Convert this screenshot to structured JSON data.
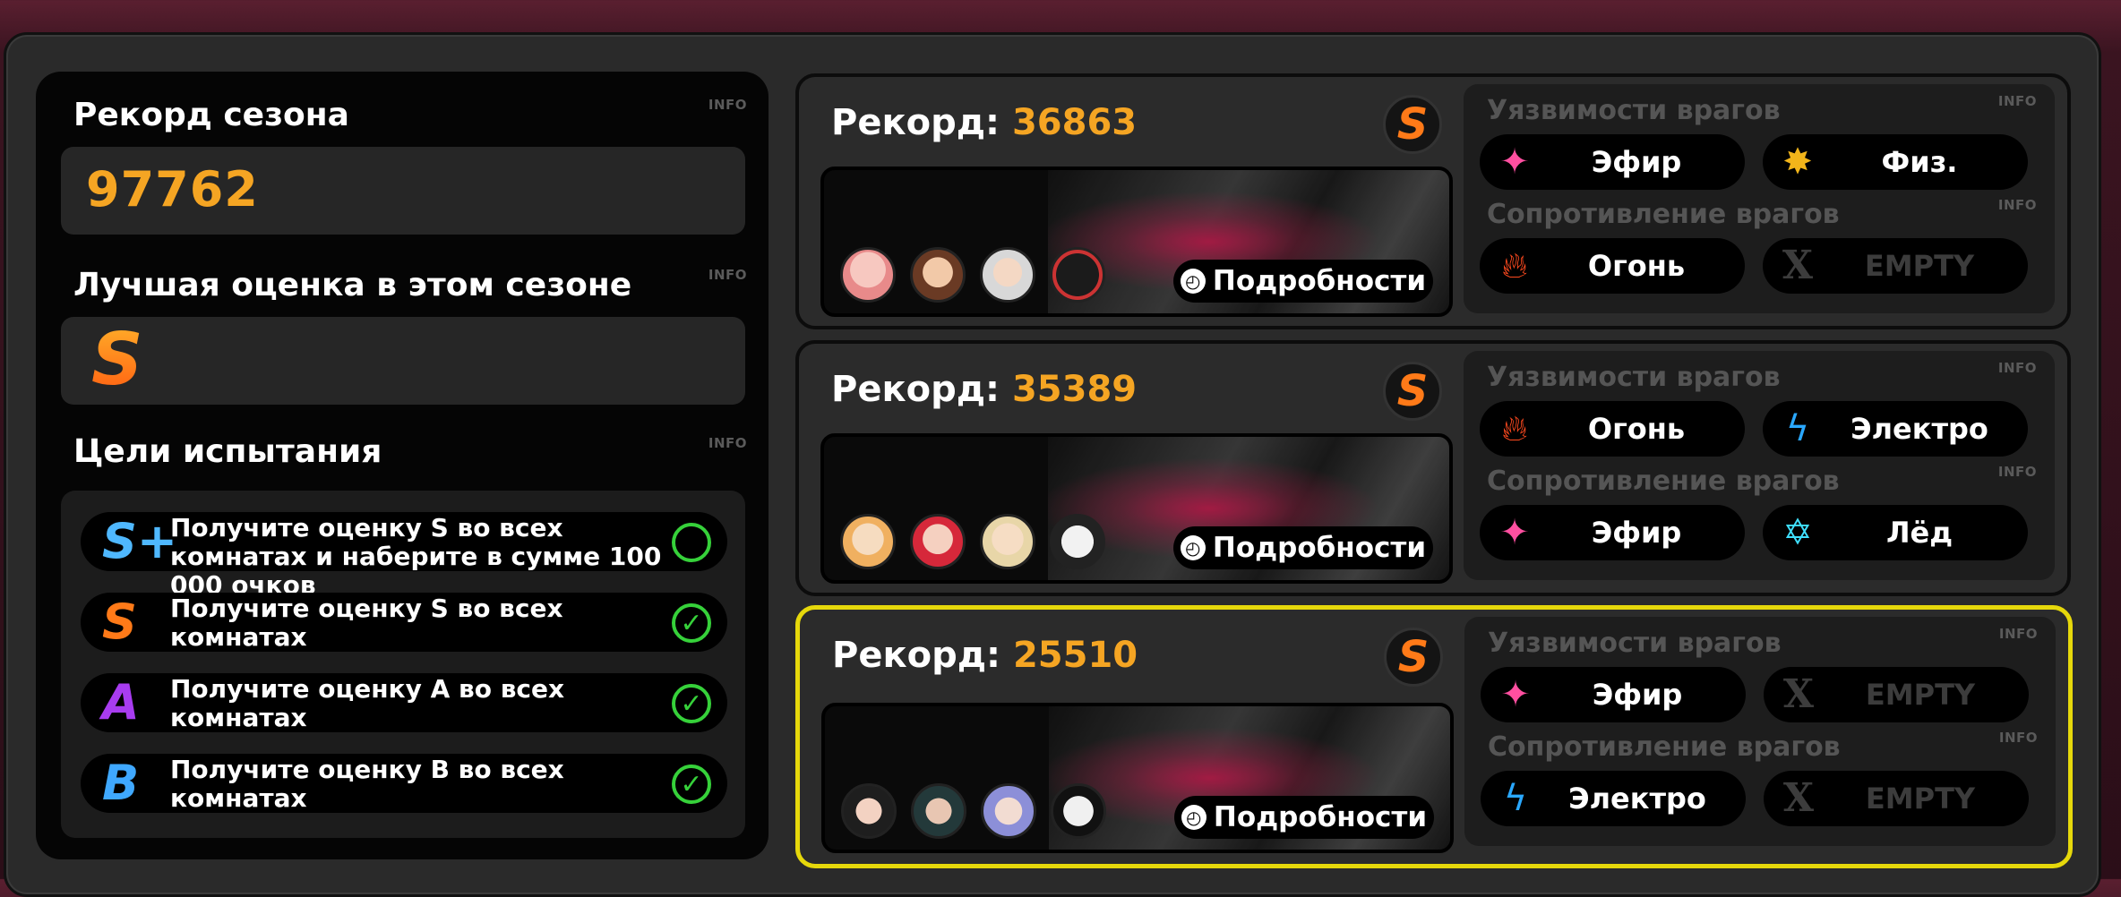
{
  "info_label": "INFO",
  "left": {
    "season_record_title": "Рекорд сезона",
    "season_record_value": "97762",
    "best_grade_title": "Лучшая оценка в этом сезоне",
    "best_grade_value": "S",
    "goals_title": "Цели испытания",
    "goals": [
      {
        "badge": "S+",
        "text": "Получите оценку S во всех комнатах и наберите в сумме 100 000 очков",
        "done": false
      },
      {
        "badge": "S",
        "text": "Получите оценку S во всех комнатах",
        "done": true
      },
      {
        "badge": "A",
        "text": "Получите оценку A во всех комнатах",
        "done": true
      },
      {
        "badge": "B",
        "text": "Получите оценку B во всех комнатах",
        "done": true
      }
    ]
  },
  "cards": [
    {
      "record_label": "Рекорд:",
      "record_value": "36863",
      "grade": "S",
      "details_label": "Подробности",
      "weak_title": "Уязвимости врагов",
      "resist_title": "Сопротивление врагов",
      "weak": [
        {
          "name": "Эфир",
          "icon": "ether-icon"
        },
        {
          "name": "Физ.",
          "icon": "physical-icon"
        }
      ],
      "resist": [
        {
          "name": "Огонь",
          "icon": "fire-icon"
        },
        {
          "name": "EMPTY",
          "icon": "empty-x-icon"
        }
      ],
      "highlighted": false
    },
    {
      "record_label": "Рекорд:",
      "record_value": "35389",
      "grade": "S",
      "details_label": "Подробности",
      "weak_title": "Уязвимости врагов",
      "resist_title": "Сопротивление врагов",
      "weak": [
        {
          "name": "Огонь",
          "icon": "fire-icon"
        },
        {
          "name": "Электро",
          "icon": "electric-icon"
        }
      ],
      "resist": [
        {
          "name": "Эфир",
          "icon": "ether-icon"
        },
        {
          "name": "Лёд",
          "icon": "ice-icon"
        }
      ],
      "highlighted": false
    },
    {
      "record_label": "Рекорд:",
      "record_value": "25510",
      "grade": "S",
      "details_label": "Подробности",
      "weak_title": "Уязвимости врагов",
      "resist_title": "Сопротивление врагов",
      "weak": [
        {
          "name": "Эфир",
          "icon": "ether-icon"
        },
        {
          "name": "EMPTY",
          "icon": "empty-x-icon"
        }
      ],
      "resist": [
        {
          "name": "Электро",
          "icon": "electric-icon"
        },
        {
          "name": "EMPTY",
          "icon": "empty-x-icon"
        }
      ],
      "highlighted": true
    }
  ],
  "colors": {
    "accent_orange": "#f5a523",
    "highlight_yellow": "#e6d80b",
    "check_green": "#36d13a",
    "ether": "#ff4fa0",
    "fire": "#ff4a1f",
    "electric": "#2aa8ff",
    "ice": "#3fe0ff",
    "physical": "#f2b51a"
  }
}
